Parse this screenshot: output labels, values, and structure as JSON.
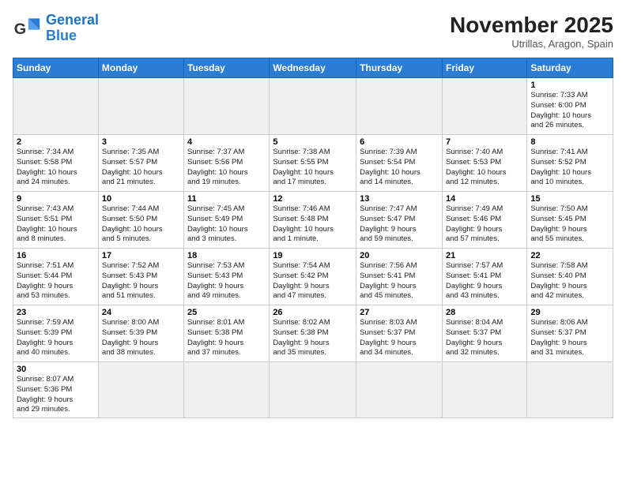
{
  "header": {
    "logo_line1": "General",
    "logo_line2": "Blue",
    "month_title": "November 2025",
    "location": "Utrillas, Aragon, Spain"
  },
  "weekdays": [
    "Sunday",
    "Monday",
    "Tuesday",
    "Wednesday",
    "Thursday",
    "Friday",
    "Saturday"
  ],
  "weeks": [
    [
      {
        "day": "",
        "info": "",
        "empty": true
      },
      {
        "day": "",
        "info": "",
        "empty": true
      },
      {
        "day": "",
        "info": "",
        "empty": true
      },
      {
        "day": "",
        "info": "",
        "empty": true
      },
      {
        "day": "",
        "info": "",
        "empty": true
      },
      {
        "day": "",
        "info": "",
        "empty": true
      },
      {
        "day": "1",
        "info": "Sunrise: 7:33 AM\nSunset: 6:00 PM\nDaylight: 10 hours\nand 26 minutes."
      }
    ],
    [
      {
        "day": "2",
        "info": "Sunrise: 7:34 AM\nSunset: 5:58 PM\nDaylight: 10 hours\nand 24 minutes."
      },
      {
        "day": "3",
        "info": "Sunrise: 7:35 AM\nSunset: 5:57 PM\nDaylight: 10 hours\nand 21 minutes."
      },
      {
        "day": "4",
        "info": "Sunrise: 7:37 AM\nSunset: 5:56 PM\nDaylight: 10 hours\nand 19 minutes."
      },
      {
        "day": "5",
        "info": "Sunrise: 7:38 AM\nSunset: 5:55 PM\nDaylight: 10 hours\nand 17 minutes."
      },
      {
        "day": "6",
        "info": "Sunrise: 7:39 AM\nSunset: 5:54 PM\nDaylight: 10 hours\nand 14 minutes."
      },
      {
        "day": "7",
        "info": "Sunrise: 7:40 AM\nSunset: 5:53 PM\nDaylight: 10 hours\nand 12 minutes."
      },
      {
        "day": "8",
        "info": "Sunrise: 7:41 AM\nSunset: 5:52 PM\nDaylight: 10 hours\nand 10 minutes."
      }
    ],
    [
      {
        "day": "9",
        "info": "Sunrise: 7:43 AM\nSunset: 5:51 PM\nDaylight: 10 hours\nand 8 minutes."
      },
      {
        "day": "10",
        "info": "Sunrise: 7:44 AM\nSunset: 5:50 PM\nDaylight: 10 hours\nand 5 minutes."
      },
      {
        "day": "11",
        "info": "Sunrise: 7:45 AM\nSunset: 5:49 PM\nDaylight: 10 hours\nand 3 minutes."
      },
      {
        "day": "12",
        "info": "Sunrise: 7:46 AM\nSunset: 5:48 PM\nDaylight: 10 hours\nand 1 minute."
      },
      {
        "day": "13",
        "info": "Sunrise: 7:47 AM\nSunset: 5:47 PM\nDaylight: 9 hours\nand 59 minutes."
      },
      {
        "day": "14",
        "info": "Sunrise: 7:49 AM\nSunset: 5:46 PM\nDaylight: 9 hours\nand 57 minutes."
      },
      {
        "day": "15",
        "info": "Sunrise: 7:50 AM\nSunset: 5:45 PM\nDaylight: 9 hours\nand 55 minutes."
      }
    ],
    [
      {
        "day": "16",
        "info": "Sunrise: 7:51 AM\nSunset: 5:44 PM\nDaylight: 9 hours\nand 53 minutes."
      },
      {
        "day": "17",
        "info": "Sunrise: 7:52 AM\nSunset: 5:43 PM\nDaylight: 9 hours\nand 51 minutes."
      },
      {
        "day": "18",
        "info": "Sunrise: 7:53 AM\nSunset: 5:43 PM\nDaylight: 9 hours\nand 49 minutes."
      },
      {
        "day": "19",
        "info": "Sunrise: 7:54 AM\nSunset: 5:42 PM\nDaylight: 9 hours\nand 47 minutes."
      },
      {
        "day": "20",
        "info": "Sunrise: 7:56 AM\nSunset: 5:41 PM\nDaylight: 9 hours\nand 45 minutes."
      },
      {
        "day": "21",
        "info": "Sunrise: 7:57 AM\nSunset: 5:41 PM\nDaylight: 9 hours\nand 43 minutes."
      },
      {
        "day": "22",
        "info": "Sunrise: 7:58 AM\nSunset: 5:40 PM\nDaylight: 9 hours\nand 42 minutes."
      }
    ],
    [
      {
        "day": "23",
        "info": "Sunrise: 7:59 AM\nSunset: 5:39 PM\nDaylight: 9 hours\nand 40 minutes."
      },
      {
        "day": "24",
        "info": "Sunrise: 8:00 AM\nSunset: 5:39 PM\nDaylight: 9 hours\nand 38 minutes."
      },
      {
        "day": "25",
        "info": "Sunrise: 8:01 AM\nSunset: 5:38 PM\nDaylight: 9 hours\nand 37 minutes."
      },
      {
        "day": "26",
        "info": "Sunrise: 8:02 AM\nSunset: 5:38 PM\nDaylight: 9 hours\nand 35 minutes."
      },
      {
        "day": "27",
        "info": "Sunrise: 8:03 AM\nSunset: 5:37 PM\nDaylight: 9 hours\nand 34 minutes."
      },
      {
        "day": "28",
        "info": "Sunrise: 8:04 AM\nSunset: 5:37 PM\nDaylight: 9 hours\nand 32 minutes."
      },
      {
        "day": "29",
        "info": "Sunrise: 8:06 AM\nSunset: 5:37 PM\nDaylight: 9 hours\nand 31 minutes."
      }
    ],
    [
      {
        "day": "30",
        "info": "Sunrise: 8:07 AM\nSunset: 5:36 PM\nDaylight: 9 hours\nand 29 minutes.",
        "last": true
      },
      {
        "day": "",
        "info": "",
        "empty": true,
        "last": true
      },
      {
        "day": "",
        "info": "",
        "empty": true,
        "last": true
      },
      {
        "day": "",
        "info": "",
        "empty": true,
        "last": true
      },
      {
        "day": "",
        "info": "",
        "empty": true,
        "last": true
      },
      {
        "day": "",
        "info": "",
        "empty": true,
        "last": true
      },
      {
        "day": "",
        "info": "",
        "empty": true,
        "last": true
      }
    ]
  ]
}
